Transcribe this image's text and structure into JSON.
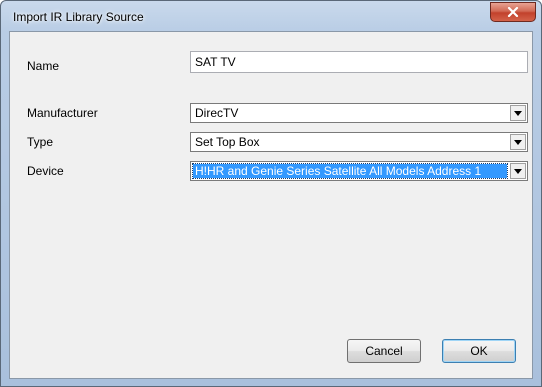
{
  "window": {
    "title": "Import IR Library Source"
  },
  "form": {
    "name_label": "Name",
    "name_value": "SAT TV",
    "manufacturer_label": "Manufacturer",
    "manufacturer_value": "DirecTV",
    "type_label": "Type",
    "type_value": "Set Top Box",
    "device_label": "Device",
    "device_value": "H!HR and Genie Series Satellite All Models Address 1"
  },
  "buttons": {
    "cancel_label": "Cancel",
    "ok_label": "OK"
  },
  "icons": {
    "close": "close-icon",
    "dropdown": "chevron-down-icon"
  },
  "colors": {
    "selection": "#3399ff",
    "close_button": "#c2412c"
  }
}
